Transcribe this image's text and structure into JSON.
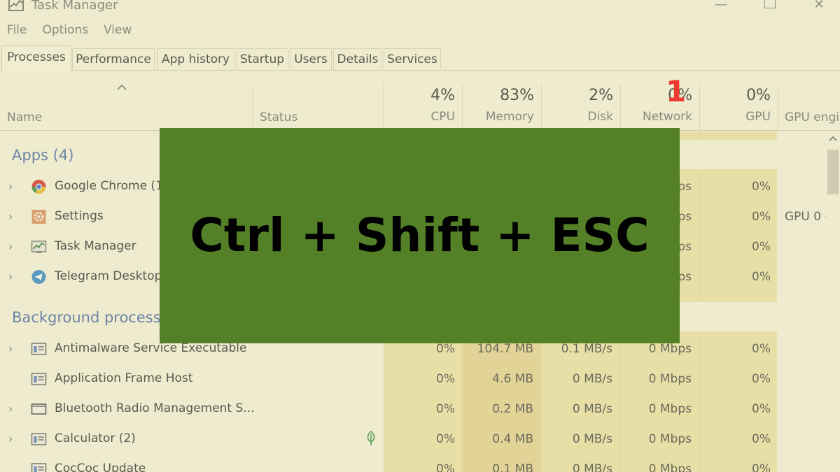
{
  "window": {
    "title": "Task Manager",
    "controls": {
      "minimize": "—",
      "close": "✕"
    }
  },
  "menu": [
    "File",
    "Options",
    "View"
  ],
  "tabs": [
    "Processes",
    "Performance",
    "App history",
    "Startup",
    "Users",
    "Details",
    "Services"
  ],
  "active_tab": "Processes",
  "columns": {
    "name": "Name",
    "status": "Status",
    "cpu": {
      "pct": "4%",
      "label": "CPU"
    },
    "memory": {
      "pct": "83%",
      "label": "Memory"
    },
    "disk": {
      "pct": "2%",
      "label": "Disk"
    },
    "network": {
      "pct": "0%",
      "label": "Network"
    },
    "gpu": {
      "pct": "0%",
      "label": "GPU"
    },
    "gpu_engine": "GPU engi"
  },
  "groups": {
    "apps": "Apps (4)",
    "background": "Background process"
  },
  "apps": [
    {
      "name": "Google Chrome (1",
      "network": "bps",
      "gpu": "0%",
      "gpu_engine": ""
    },
    {
      "name": "Settings",
      "network": "bps",
      "gpu": "0%",
      "gpu_engine": "GPU 0 -"
    },
    {
      "name": "Task Manager",
      "network": "bps",
      "gpu": "0%",
      "gpu_engine": ""
    },
    {
      "name": "Telegram Desktop",
      "network": "bps",
      "gpu": "0%",
      "gpu_engine": ""
    }
  ],
  "background": [
    {
      "name": "Antimalware Service Executable",
      "cpu": "0%",
      "memory": "104.7 MB",
      "disk": "0.1 MB/s",
      "network": "0 Mbps",
      "gpu": "0%"
    },
    {
      "name": "Application Frame Host",
      "cpu": "0%",
      "memory": "4.6 MB",
      "disk": "0 MB/s",
      "network": "0 Mbps",
      "gpu": "0%"
    },
    {
      "name": "Bluetooth Radio Management S...",
      "cpu": "0%",
      "memory": "0.2 MB",
      "disk": "0 MB/s",
      "network": "0 Mbps",
      "gpu": "0%"
    },
    {
      "name": "Calculator (2)",
      "cpu": "0%",
      "memory": "0.4 MB",
      "disk": "0 MB/s",
      "network": "0 Mbps",
      "gpu": "0%"
    },
    {
      "name": "CocCoc Update",
      "cpu": "0%",
      "memory": "0.1 MB",
      "disk": "0 MB/s",
      "network": "0 Mbps",
      "gpu": "0%"
    }
  ],
  "overlay": {
    "shortcut": "Ctrl + Shift + ESC",
    "step_number": "1",
    "background_color": "#548127",
    "step_color": "#ee3b32"
  }
}
